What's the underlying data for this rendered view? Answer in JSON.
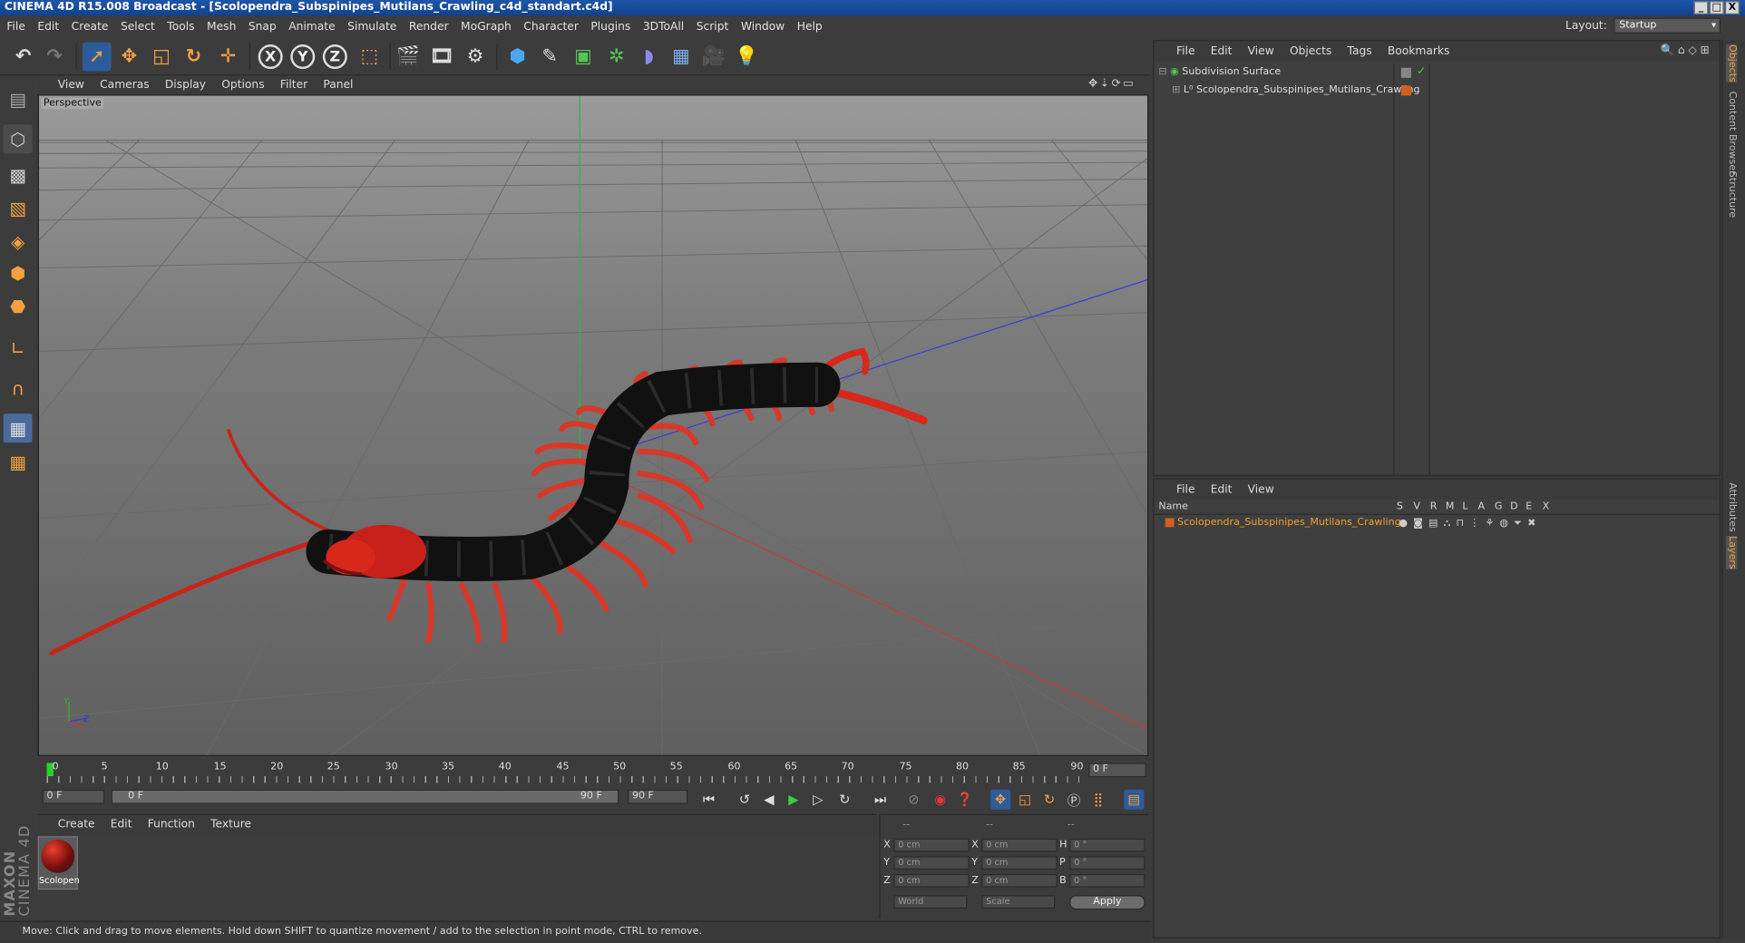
{
  "window": {
    "title": "CINEMA 4D R15.008 Broadcast - [Scolopendra_Subspinipes_Mutilans_Crawling_c4d_standart.c4d]",
    "buttons": [
      "_",
      "□",
      "X"
    ]
  },
  "menubar": {
    "items": [
      "File",
      "Edit",
      "Create",
      "Select",
      "Tools",
      "Mesh",
      "Snap",
      "Animate",
      "Simulate",
      "Render",
      "MoGraph",
      "Character",
      "Plugins",
      "3DToAll",
      "Script",
      "Window",
      "Help"
    ],
    "layout_label": "Layout:",
    "layout_value": "Startup"
  },
  "viewport": {
    "menu": [
      "View",
      "Cameras",
      "Display",
      "Options",
      "Filter",
      "Panel"
    ],
    "label": "Perspective",
    "axis_y": "Y",
    "axis_z": "Z"
  },
  "timeline": {
    "ticks": [
      "0",
      "5",
      "10",
      "15",
      "20",
      "25",
      "30",
      "35",
      "40",
      "45",
      "50",
      "55",
      "60",
      "65",
      "70",
      "75",
      "80",
      "85",
      "90"
    ],
    "current_frame": "0 F",
    "start_field": "0 F",
    "range_start": "0 F",
    "range_end": "90 F",
    "end_field": "90 F"
  },
  "materials": {
    "menu": [
      "Create",
      "Edit",
      "Function",
      "Texture"
    ],
    "items": [
      {
        "label": "Scolopen"
      }
    ]
  },
  "coordinates": {
    "header": [
      "--",
      "--",
      "--"
    ],
    "rows": [
      {
        "axis": "X",
        "pos": "0 cm",
        "axis2": "X",
        "size": "0 cm",
        "axis3": "H",
        "rot": "0 °"
      },
      {
        "axis": "Y",
        "pos": "0 cm",
        "axis2": "Y",
        "size": "0 cm",
        "axis3": "P",
        "rot": "0 °"
      },
      {
        "axis": "Z",
        "pos": "0 cm",
        "axis2": "Z",
        "size": "0 cm",
        "axis3": "B",
        "rot": "0 °"
      }
    ],
    "mode_world": "World",
    "mode_scale": "Scale",
    "apply_label": "Apply"
  },
  "status_text": "Move: Click and drag to move elements. Hold down SHIFT to quantize movement / add to the selection in point mode, CTRL to remove.",
  "object_manager": {
    "menu": [
      "File",
      "Edit",
      "View",
      "Objects",
      "Tags",
      "Bookmarks"
    ],
    "objects": [
      {
        "name": "Subdivision Surface"
      },
      {
        "name": "Scolopendra_Subspinipes_Mutilans_Crawling"
      }
    ]
  },
  "layer_manager": {
    "menu": [
      "File",
      "Edit",
      "View"
    ],
    "name_header": "Name",
    "columns": [
      "S",
      "V",
      "R",
      "M",
      "L",
      "A",
      "G",
      "D",
      "E",
      "X"
    ],
    "layers": [
      {
        "name": "Scolopendra_Subspinipes_Mutilans_Crawling",
        "color": "#d0601e"
      }
    ]
  },
  "side_tabs": [
    "Objects",
    "Content Browser",
    "Structure",
    "Attributes",
    "Layers"
  ],
  "colors": {
    "accent_blue": "#1b4ea0",
    "centipede_red": "#d8281c",
    "centipede_body": "#141414",
    "layer_text": "#f0a030"
  }
}
